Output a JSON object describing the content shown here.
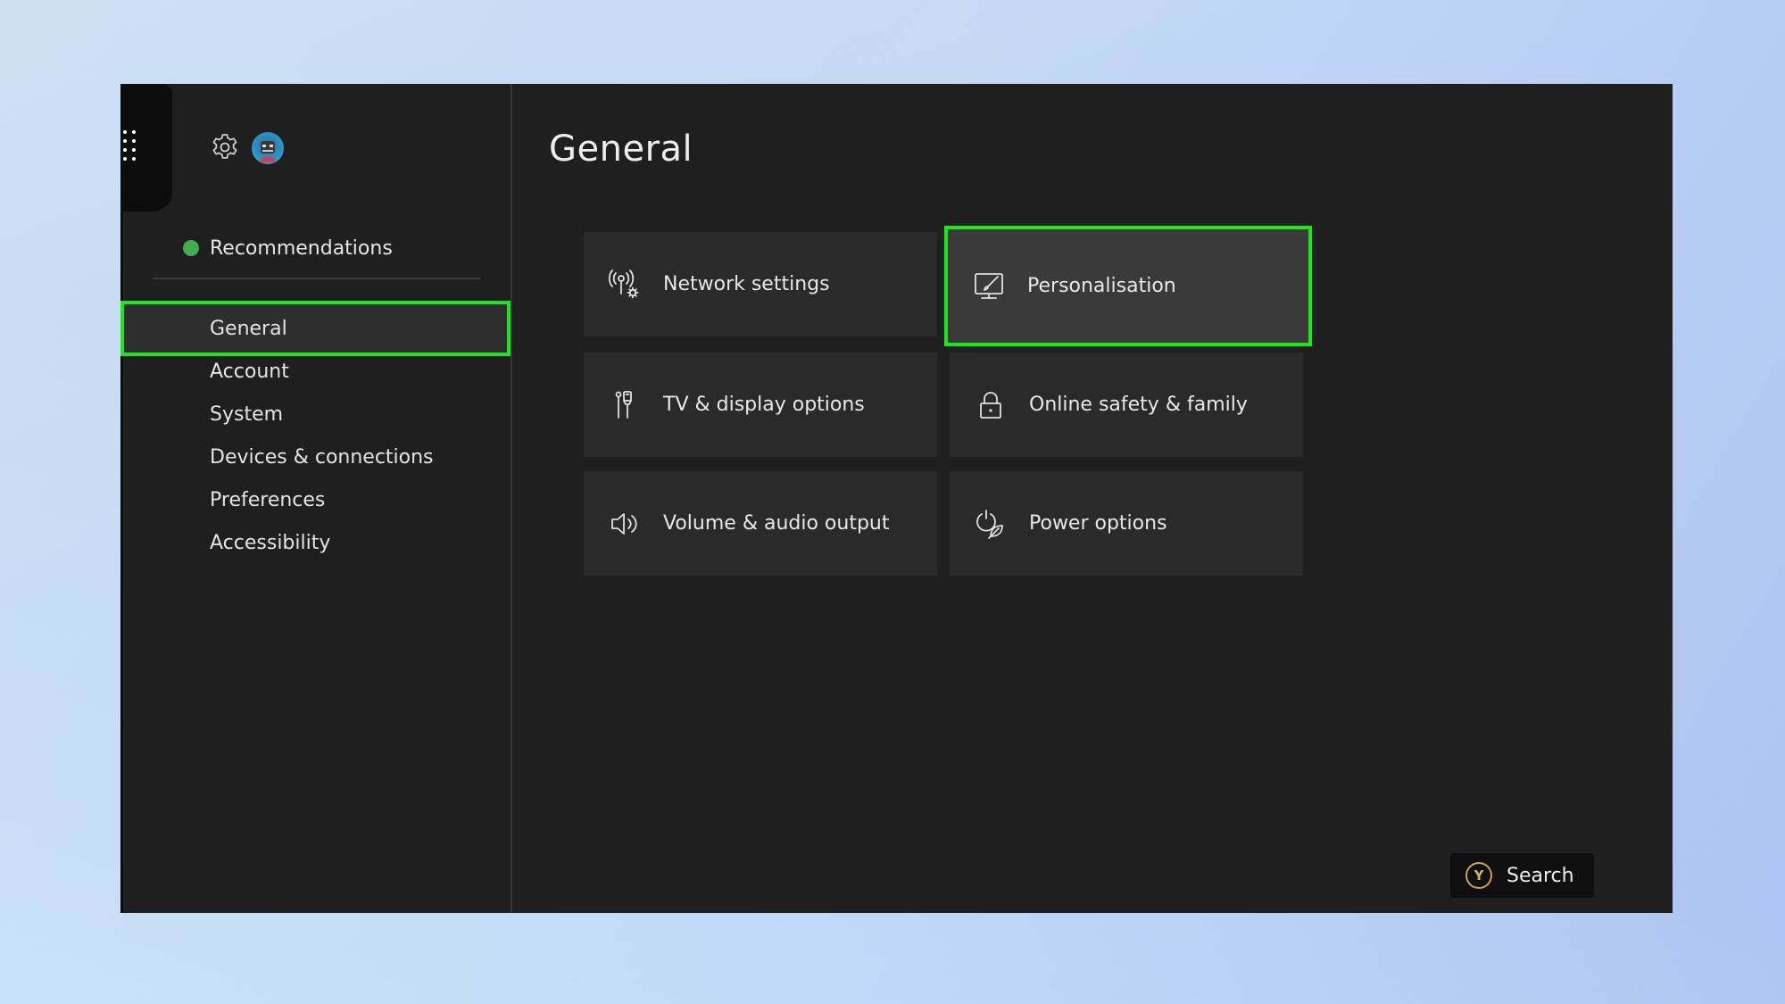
{
  "header": {
    "page_title": "General"
  },
  "sidebar": {
    "recommendations": {
      "label": "Recommendations",
      "status_color": "#3fae4f"
    },
    "items": [
      {
        "label": "General",
        "selected": true
      },
      {
        "label": "Account",
        "selected": false
      },
      {
        "label": "System",
        "selected": false
      },
      {
        "label": "Devices & connections",
        "selected": false
      },
      {
        "label": "Preferences",
        "selected": false
      },
      {
        "label": "Accessibility",
        "selected": false
      }
    ]
  },
  "tiles": [
    {
      "label": "Network settings",
      "icon": "network-settings-icon",
      "selected": false
    },
    {
      "label": "Personalisation",
      "icon": "personalisation-icon",
      "selected": true
    },
    {
      "label": "TV & display options",
      "icon": "tv-display-icon",
      "selected": false
    },
    {
      "label": "Online safety & family",
      "icon": "lock-icon",
      "selected": false
    },
    {
      "label": "Volume & audio output",
      "icon": "speaker-icon",
      "selected": false
    },
    {
      "label": "Power options",
      "icon": "power-leaf-icon",
      "selected": false
    }
  ],
  "footer": {
    "search_button": {
      "badge": "Y",
      "label": "Search"
    }
  },
  "colors": {
    "highlight": "#1ee61e",
    "panel_bg": "#1f1f1f",
    "tile_bg": "#2a2a2a",
    "y_button": "#c6a450"
  }
}
